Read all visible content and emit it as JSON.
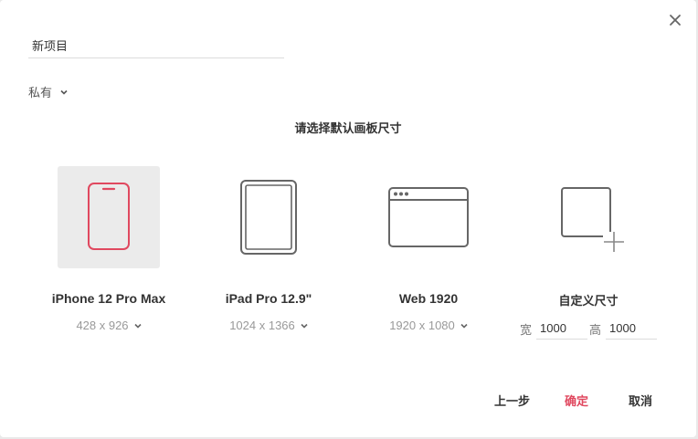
{
  "project": {
    "name": "新项目",
    "privacy": "私有"
  },
  "heading": "请选择默认画板尺寸",
  "presets": [
    {
      "title": "iPhone 12 Pro Max",
      "size": "428 x 926",
      "icon": "phone-icon",
      "selected": true
    },
    {
      "title": "iPad Pro 12.9\"",
      "size": "1024 x 1366",
      "icon": "tablet-icon",
      "selected": false
    },
    {
      "title": "Web 1920",
      "size": "1920 x 1080",
      "icon": "browser-window-icon",
      "selected": false
    },
    {
      "title": "自定义尺寸",
      "icon": "custom-size-add-icon",
      "selected": false,
      "width_label": "宽",
      "width_value": "1000",
      "height_label": "高",
      "height_value": "1000"
    }
  ],
  "buttons": {
    "prev": "上一步",
    "confirm": "确定",
    "cancel": "取消"
  },
  "colors": {
    "accent": "#e0485f",
    "icon_stroke": "#666666",
    "selected_bg": "#ebebeb"
  }
}
